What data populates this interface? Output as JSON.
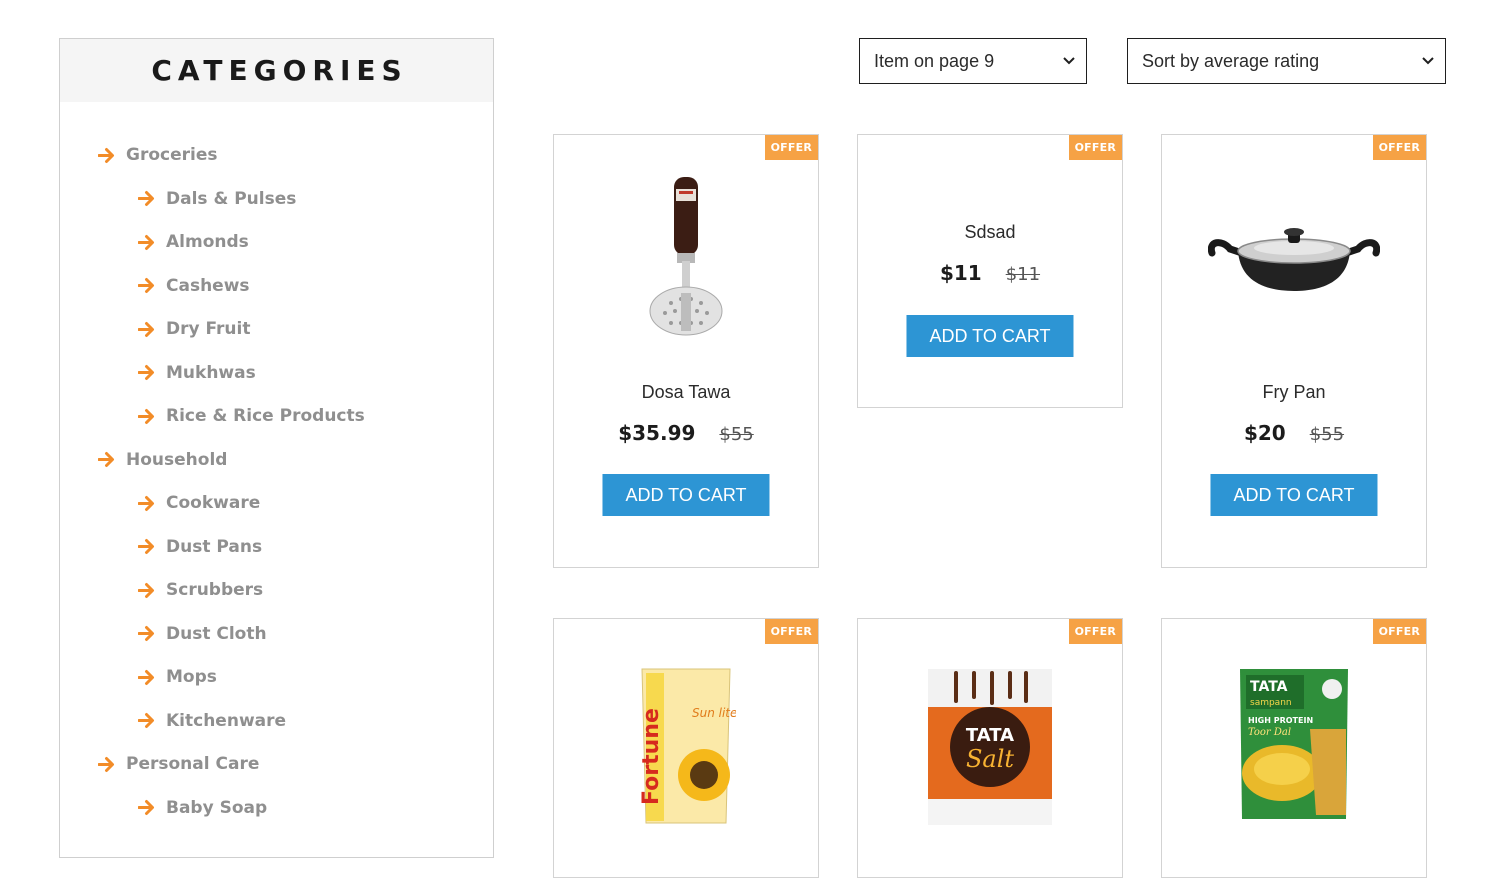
{
  "sidebar": {
    "title": "CATEGORIES",
    "accent_color": "#f28c28",
    "items": [
      {
        "label": "Groceries",
        "level": 0
      },
      {
        "label": "Dals & Pulses",
        "level": 1
      },
      {
        "label": "Almonds",
        "level": 1
      },
      {
        "label": "Cashews",
        "level": 1
      },
      {
        "label": "Dry Fruit",
        "level": 1
      },
      {
        "label": "Mukhwas",
        "level": 1
      },
      {
        "label": "Rice & Rice Products",
        "level": 1
      },
      {
        "label": "Household",
        "level": 0
      },
      {
        "label": "Cookware",
        "level": 1
      },
      {
        "label": "Dust Pans",
        "level": 1
      },
      {
        "label": "Scrubbers",
        "level": 1
      },
      {
        "label": "Dust Cloth",
        "level": 1
      },
      {
        "label": "Mops",
        "level": 1
      },
      {
        "label": "Kitchenware",
        "level": 1
      },
      {
        "label": "Personal Care",
        "level": 0
      },
      {
        "label": "Baby Soap",
        "level": 1
      }
    ]
  },
  "toolbar": {
    "items_per_page": "Item on page 9",
    "sort_by": "Sort by average rating"
  },
  "products": [
    {
      "name": "Dosa Tawa",
      "price": "$35.99",
      "old_price": "$55",
      "badge": "OFFER",
      "button": "ADD TO CART",
      "image_icon": "potato-masher-icon"
    },
    {
      "name": "Sdsad",
      "price": "$11",
      "old_price": "$11",
      "badge": "OFFER",
      "button": "ADD TO CART",
      "image_icon": ""
    },
    {
      "name": "Fry Pan",
      "price": "$20",
      "old_price": "$55",
      "badge": "OFFER",
      "button": "ADD TO CART",
      "image_icon": "kadai-pan-icon"
    },
    {
      "name": "",
      "badge": "OFFER",
      "image_icon": "oil-pouch-icon",
      "brand": "Fortune",
      "sub_brand": "Sun lite"
    },
    {
      "name": "",
      "badge": "OFFER",
      "image_icon": "salt-pack-icon",
      "brand": "TATA",
      "product_word": "Salt"
    },
    {
      "name": "",
      "badge": "OFFER",
      "image_icon": "dal-pack-icon",
      "brand": "TATA",
      "sub_brand": "sampann",
      "line1": "HIGH PROTEIN",
      "line2": "Toor Dal"
    }
  ],
  "colors": {
    "button_blue": "#2d95d4",
    "offer_orange": "#f6a245",
    "category_gray": "#8f8f8f"
  }
}
